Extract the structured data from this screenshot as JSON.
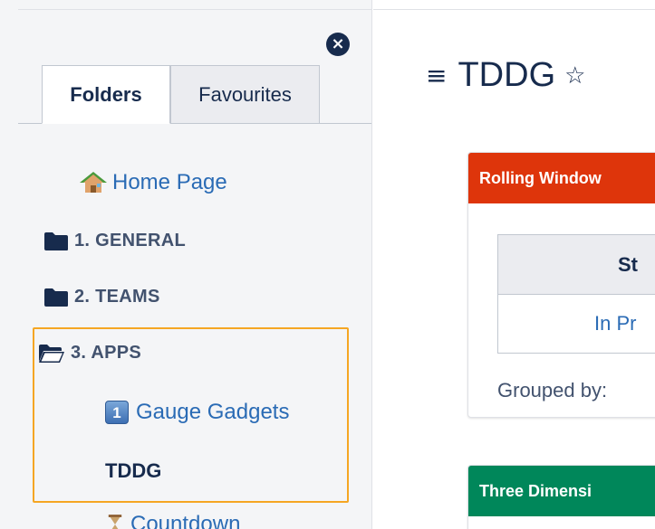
{
  "sidebar": {
    "tabs": [
      {
        "label": "Folders",
        "active": true
      },
      {
        "label": "Favourites",
        "active": false
      }
    ],
    "close_glyph": "×",
    "items": [
      {
        "label": "Home Page",
        "icon": "house-icon"
      },
      {
        "label": "1. GENERAL",
        "icon": "folder-icon"
      },
      {
        "label": "2. TEAMS",
        "icon": "folder-icon"
      },
      {
        "label": "3. APPS",
        "icon": "folder-open-icon"
      },
      {
        "label": "Gauge Gadgets",
        "icon": "keycap-1-icon",
        "badge": "1"
      },
      {
        "label": "TDDG",
        "current": true
      },
      {
        "label": "Countdown",
        "icon": "hourglass-icon"
      }
    ]
  },
  "main": {
    "menu_glyph": "≡",
    "star_glyph": "☆",
    "title": "TDDG",
    "cards": [
      {
        "title": "Rolling Window",
        "header_color": "#de350b",
        "table_header": "St",
        "table_cell": "In Pr",
        "grouped_label": "Grouped by:"
      },
      {
        "title": "Three Dimensi",
        "header_color": "#00875a"
      }
    ]
  },
  "colors": {
    "link": "#2a6bb5",
    "highlight": "#f5a623",
    "folder": "#172b4d"
  }
}
